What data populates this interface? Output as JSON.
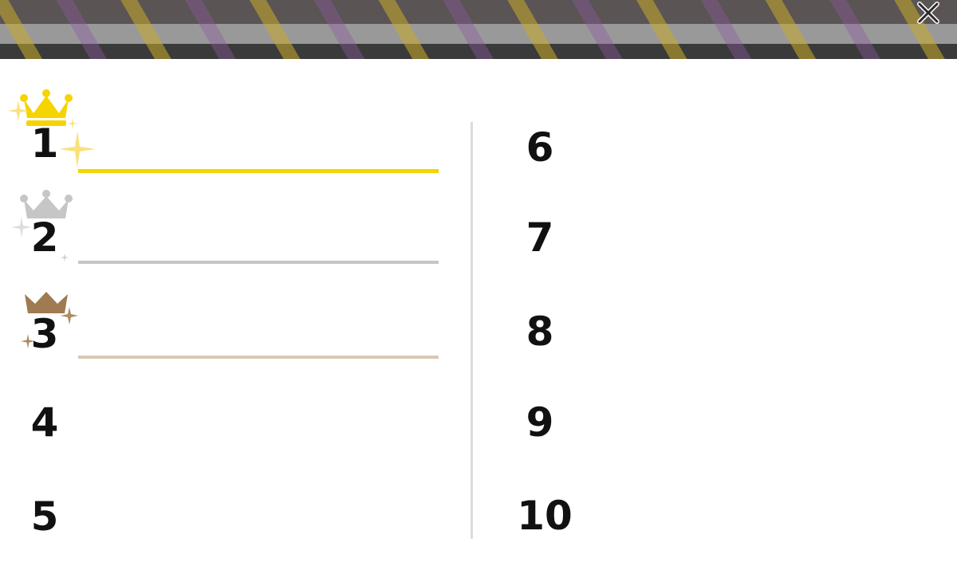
{
  "colors": {
    "gold": "#f5d400",
    "silver": "#c6c6c6",
    "bronze": "#a07a50",
    "bronze_line": "#d8c8b4",
    "divider": "#dcdcdc"
  },
  "header": {
    "close_icon": "close-icon"
  },
  "left_column": [
    {
      "rank": "1",
      "medal": "gold"
    },
    {
      "rank": "2",
      "medal": "silver"
    },
    {
      "rank": "3",
      "medal": "bronze"
    },
    {
      "rank": "4",
      "medal": ""
    },
    {
      "rank": "5",
      "medal": ""
    }
  ],
  "right_column": [
    {
      "rank": "6"
    },
    {
      "rank": "7"
    },
    {
      "rank": "8"
    },
    {
      "rank": "9"
    },
    {
      "rank": "10"
    }
  ]
}
